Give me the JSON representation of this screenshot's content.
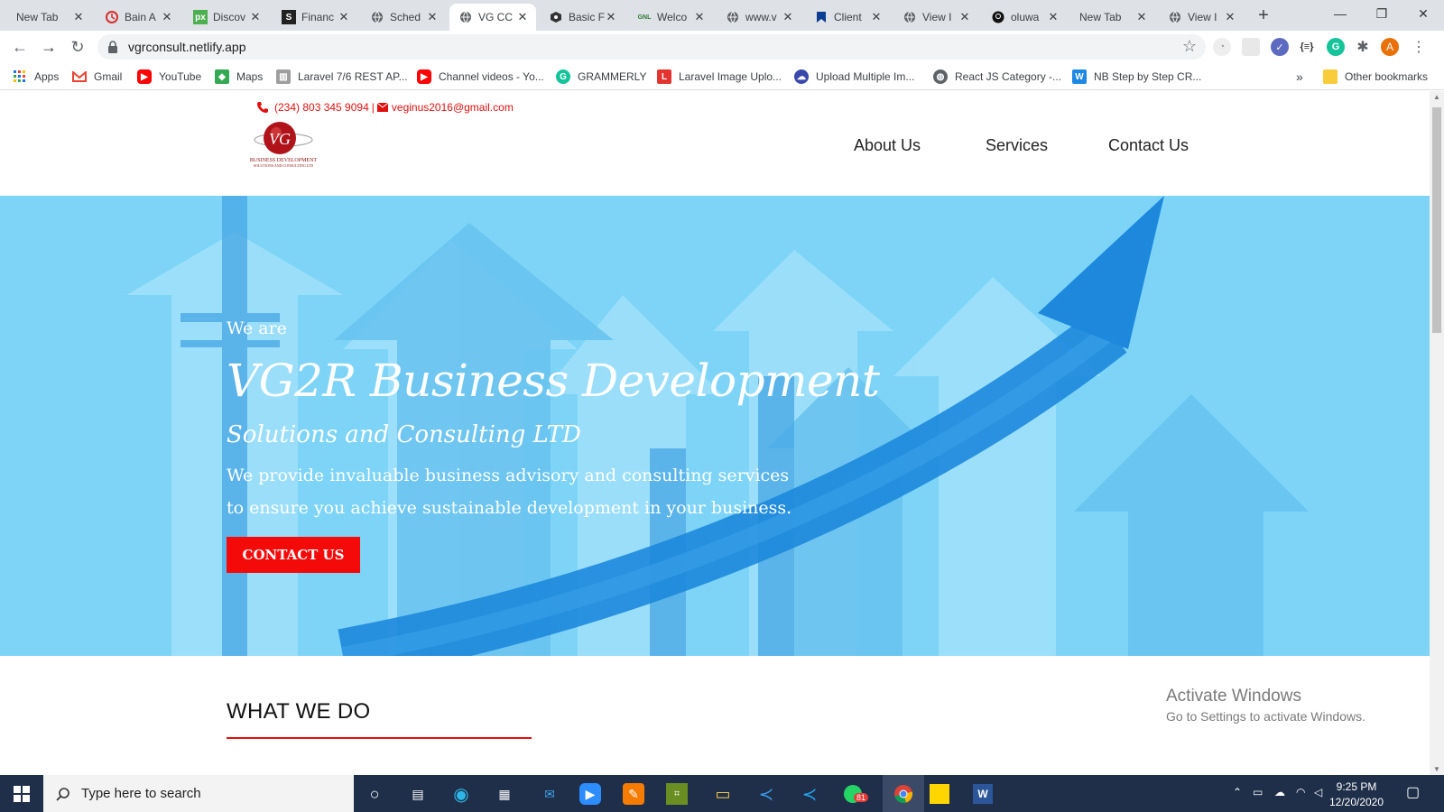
{
  "browser": {
    "tabs": [
      {
        "label": "New Tab",
        "icon": "blank-icon"
      },
      {
        "label": "Bain A",
        "icon": "opera-icon"
      },
      {
        "label": "Discov",
        "icon": "px-icon"
      },
      {
        "label": "Financ",
        "icon": "s-icon"
      },
      {
        "label": "Sched",
        "icon": "globe-icon"
      },
      {
        "label": "VG CC",
        "icon": "globe-icon"
      },
      {
        "label": "Basic F",
        "icon": "hex-icon"
      },
      {
        "label": "Welco",
        "icon": "gnl-icon"
      },
      {
        "label": "www.v",
        "icon": "globe-icon"
      },
      {
        "label": "Client",
        "icon": "bookmark-icon"
      },
      {
        "label": "View I",
        "icon": "globe-icon"
      },
      {
        "label": "oluwa",
        "icon": "github-icon"
      },
      {
        "label": "New Tab",
        "icon": "blank-icon"
      },
      {
        "label": "View I",
        "icon": "globe-icon"
      }
    ],
    "active_tab_index": 5,
    "url": "vgrconsult.netlify.app",
    "profile_initial": "A",
    "bookmarks": [
      {
        "label": "Apps",
        "icon": "apps-grid-icon",
        "color": "#1a73e8"
      },
      {
        "label": "Gmail",
        "icon": "gmail-icon",
        "color": "#ea4335"
      },
      {
        "label": "YouTube",
        "icon": "youtube-icon",
        "color": "#ff0000"
      },
      {
        "label": "Maps",
        "icon": "maps-icon",
        "color": "#34a853"
      },
      {
        "label": "Laravel 7/6 REST AP...",
        "icon": "laravel-icon",
        "color": "#7a7a7a"
      },
      {
        "label": "Channel videos - Yo...",
        "icon": "youtube-icon",
        "color": "#ff0000"
      },
      {
        "label": "GRAMMERLY",
        "icon": "grammarly-icon",
        "color": "#15c39a"
      },
      {
        "label": "Laravel Image Uplo...",
        "icon": "laravel-icon",
        "color": "#e3342f"
      },
      {
        "label": "Upload Multiple Im...",
        "icon": "cloud-icon",
        "color": "#3949ab"
      },
      {
        "label": "React JS Category -...",
        "icon": "globe-icon",
        "color": "#5f6368"
      },
      {
        "label": "NB Step by Step CR...",
        "icon": "w-icon",
        "color": "#1e88e5"
      }
    ],
    "more_bookmarks": "»",
    "other_bookmarks": "Other bookmarks"
  },
  "site": {
    "phone": "(234) 803 345 9094",
    "separator": "|",
    "email": "veginus2016@gmail.com",
    "logo_text": "BUSINESS DEVELOPMENT",
    "logo_subtext": "SOLUTIONS AND CONSULTING LTD",
    "logo_mark": "VG",
    "nav": [
      "About Us",
      "Services",
      "Contact Us"
    ],
    "hero": {
      "intro": "We are",
      "title": "VG2R Business Development",
      "subtitle": "Solutions and Consulting LTD",
      "desc_line1": "We provide invaluable business advisory and consulting services",
      "desc_line2": "to ensure you achieve sustainable development in your business.",
      "cta": "CONTACT US"
    },
    "section_title": "WHAT WE DO",
    "colors": {
      "accent": "#f50a0a",
      "hero_bg": "#7dd4f7",
      "arrow": "#1e8ee0"
    }
  },
  "watermark": {
    "line1": "Activate Windows",
    "line2": "Go to Settings to activate Windows."
  },
  "taskbar": {
    "search_placeholder": "Type here to search",
    "whatsapp_badge": "81",
    "time": "9:25 PM",
    "date": "12/20/2020"
  }
}
